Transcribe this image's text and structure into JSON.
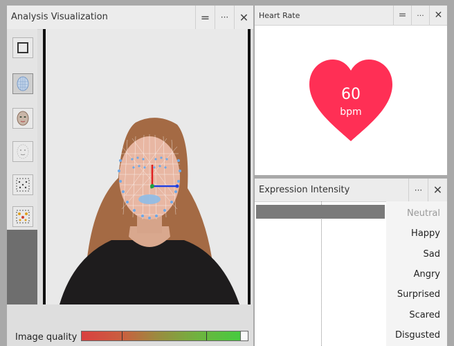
{
  "analysis": {
    "title": "Analysis Visualization",
    "buttons": [
      "=",
      "···",
      "✕"
    ],
    "tools": [
      "frame-tool",
      "face-mesh-tool",
      "face-texture-tool",
      "face-landmark-tool",
      "landmark-points-tool",
      "action-units-tool"
    ],
    "quality": {
      "label": "Image quality",
      "level": 0.96
    }
  },
  "heart_rate": {
    "title": "Heart Rate",
    "buttons": [
      "=",
      "···",
      "✕"
    ],
    "value": "60",
    "unit": "bpm",
    "heart_color": "#ff2f55"
  },
  "expression": {
    "title": "Expression Intensity",
    "buttons": [
      "···",
      "✕"
    ],
    "labels": [
      "Neutral",
      "Happy",
      "Sad",
      "Angry",
      "Surprised",
      "Scared",
      "Disgusted"
    ],
    "intensities": [
      1.0,
      0,
      0,
      0,
      0,
      0,
      0
    ],
    "bar_color": "#7a7a7a"
  }
}
